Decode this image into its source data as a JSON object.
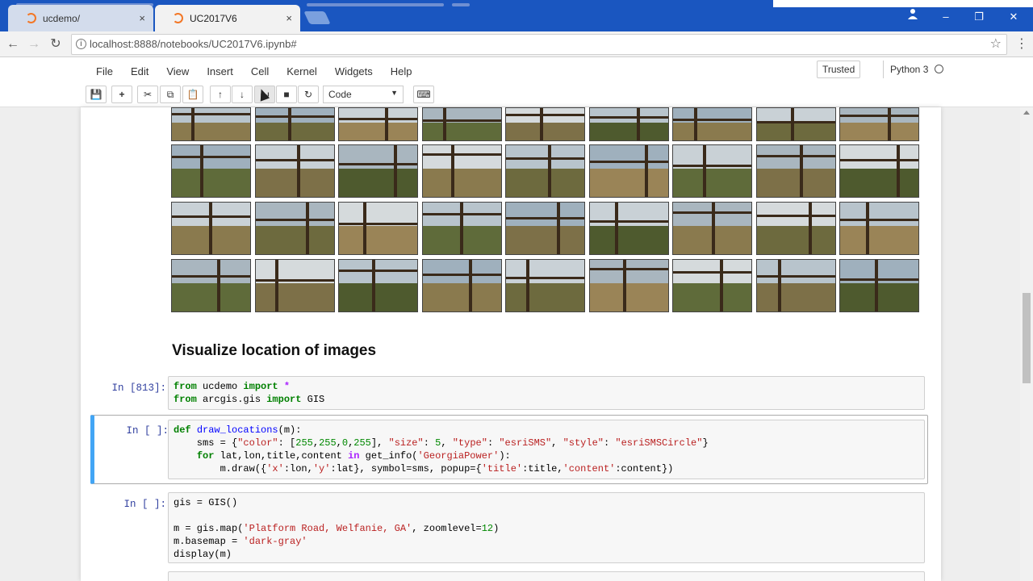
{
  "browser": {
    "tabs": [
      {
        "title": "ucdemo/",
        "close": "×"
      },
      {
        "title": "UC2017V6",
        "close": "×"
      }
    ],
    "url": "localhost:8888/notebooks/UC2017V6.ipynb#",
    "window_controls": {
      "minimize": "–",
      "restore": "❐",
      "close": "✕"
    },
    "nav": {
      "back": "←",
      "forward": "→",
      "reload": "↻"
    },
    "star": "☆",
    "menu": "⋮",
    "info": "i"
  },
  "jupyter": {
    "menu": [
      "File",
      "Edit",
      "View",
      "Insert",
      "Cell",
      "Kernel",
      "Widgets",
      "Help"
    ],
    "trusted": "Trusted",
    "kernel": "Python 3",
    "toolbar": {
      "save": "💾",
      "add": "+",
      "cut": "✂",
      "copy": "⧉",
      "paste": "📋",
      "move_up": "↑",
      "move_down": "↓",
      "run": "⏭",
      "stop": "■",
      "restart": "↻",
      "keyboard": "⌨"
    },
    "cell_type": "Code",
    "cell_type_caret": "▼"
  },
  "notebook": {
    "heading": "Visualize location of images",
    "cells": [
      {
        "prompt": "In [813]:",
        "lines": [
          "from ucdemo import *",
          "from arcgis.gis import GIS"
        ]
      },
      {
        "prompt": "In [ ]:",
        "lines": [
          "def draw_locations(m):",
          "    sms = {\"color\": [255,255,0,255], \"size\": 5, \"type\": \"esriSMS\", \"style\": \"esriSMSCircle\"}",
          "    for lat,lon,title,content in get_info('GeorgiaPower'):",
          "        m.draw({'x':lon,'y':lat}, symbol=sms, popup={'title':title,'content':content})"
        ]
      },
      {
        "prompt": "In [ ]:",
        "lines": [
          "gis = GIS()",
          "",
          "m = gis.map('Platform Road, Welfanie, GA', zoomlevel=12)",
          "m.basemap = 'dark-gray'",
          "display(m)"
        ]
      }
    ]
  },
  "colors": {
    "tabbar": "#1a56c0",
    "selected_cell_accent": "#42a5f5",
    "prompt": "#303f9f",
    "keyword": "#008000",
    "string": "#ba2121"
  }
}
